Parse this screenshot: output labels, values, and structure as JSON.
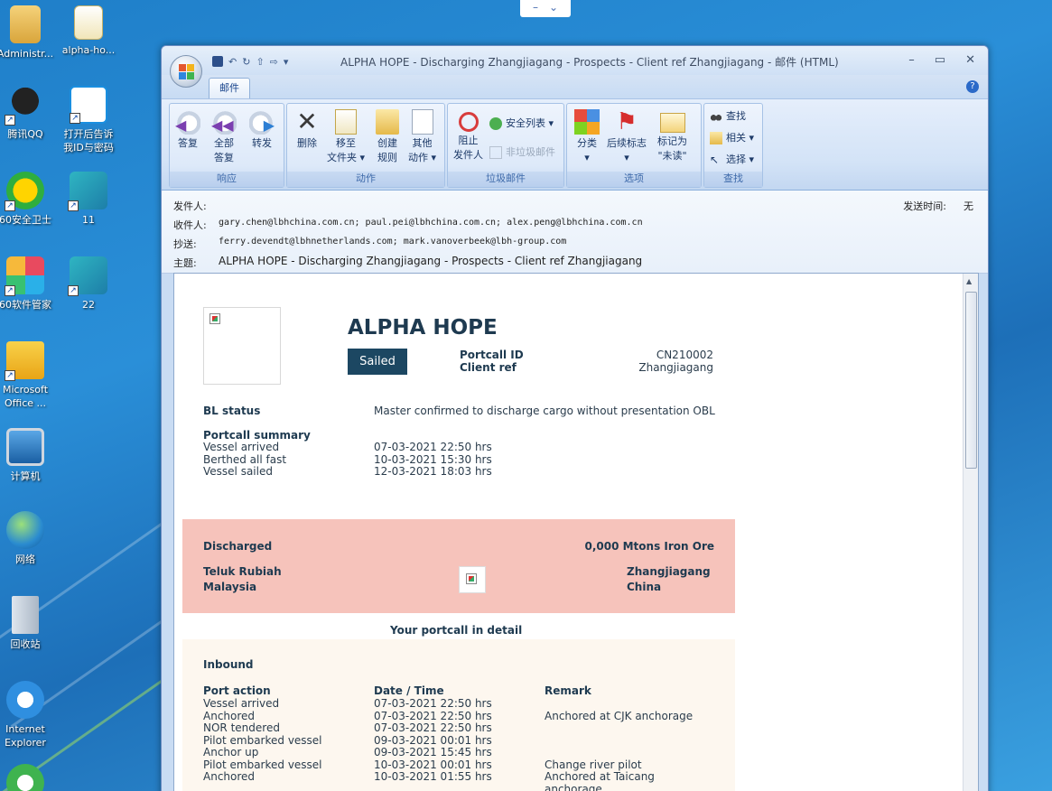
{
  "desktop": {
    "icons": [
      {
        "label": "Administr...",
        "icon": "folder-user-icon"
      },
      {
        "label": "alpha-ho...",
        "icon": "outlook-message-icon"
      },
      {
        "label": "腾讯QQ",
        "icon": "qq-penguin-icon"
      },
      {
        "label": "打开后告诉\n我ID与密码",
        "icon": "remote-desktop-icon"
      },
      {
        "label": "60安全卫士",
        "icon": "security-guard-icon"
      },
      {
        "label": "11",
        "icon": "registry-file-icon"
      },
      {
        "label": "60软件管家",
        "icon": "software-manager-icon"
      },
      {
        "label": "22",
        "icon": "registry-file-icon"
      },
      {
        "label": "Microsoft\nOffice ...",
        "icon": "office-outlook-icon"
      },
      {
        "label": "计算机",
        "icon": "computer-icon"
      },
      {
        "label": "网络",
        "icon": "network-globe-icon"
      },
      {
        "label": "回收站",
        "icon": "recycle-bin-icon"
      },
      {
        "label": "Internet\nExplorer",
        "icon": "internet-explorer-icon"
      }
    ]
  },
  "topbar": {
    "minus": "–",
    "chevron": "⌄"
  },
  "window": {
    "title": "ALPHA HOPE - Discharging Zhangjiagang - Prospects - Client ref Zhangjiagang  - 邮件 (HTML)",
    "min": "–",
    "max": "▭",
    "close": "✕",
    "tab": "邮件",
    "help": "?"
  },
  "ribbon": {
    "groups": {
      "respond": "响应",
      "actions": "动作",
      "junk": "垃圾邮件",
      "options": "选项",
      "find": "查找"
    },
    "buttons": {
      "reply": "答复",
      "reply_all_1": "全部",
      "reply_all_2": "答复",
      "forward": "转发",
      "delete": "删除",
      "move_1": "移至",
      "move_2": "文件夹 ▾",
      "create_1": "创建",
      "create_2": "规则",
      "other_1": "其他",
      "other_2": "动作 ▾",
      "block_1": "阻止",
      "block_2": "发件人",
      "safe_list": "安全列表 ▾",
      "not_junk": "非垃圾邮件",
      "categorize_1": "分类",
      "categorize_2": "▾",
      "followup_1": "后续标志",
      "followup_2": "▾",
      "mark_1": "标记为",
      "mark_2": "\"未读\"",
      "find": "查找",
      "related": "相关 ▾",
      "select": "选择 ▾"
    }
  },
  "header": {
    "from_label": "发件人:",
    "to_label": "收件人:",
    "to_value": "gary.chen@lbhchina.com.cn; paul.pei@lbhchina.com.cn; alex.peng@lbhchina.com.cn",
    "cc_label": "抄送:",
    "cc_value": "ferry.devendt@lbhnetherlands.com; mark.vanoverbeek@lbh-group.com",
    "subject_label": "主题:",
    "subject_value": "ALPHA HOPE - Discharging Zhangjiagang - Prospects - Client ref Zhangjiagang",
    "sent_label": "发送时间:",
    "sent_value": "无"
  },
  "message": {
    "vessel": "ALPHA HOPE",
    "status": "Sailed",
    "portcall_id_label": "Portcall ID",
    "portcall_id_value": "CN210002",
    "client_ref_label": "Client ref",
    "client_ref_value": "Zhangjiagang",
    "bl_status_label": "BL status",
    "bl_status_value": "Master confirmed to discharge cargo without presentation OBL",
    "summary_title": "Portcall summary",
    "summary": [
      {
        "label": "Vessel arrived",
        "value": "07-03-2021 22:50 hrs"
      },
      {
        "label": "Berthed all fast",
        "value": "10-03-2021 15:30 hrs"
      },
      {
        "label": "Vessel sailed",
        "value": "12-03-2021 18:03 hrs"
      }
    ],
    "discharged_label": "Discharged",
    "cargo": "0,000 Mtons Iron Ore",
    "origin_1": "Teluk Rubiah",
    "origin_2": "Malaysia",
    "dest_1": "Zhangjiagang",
    "dest_2": "China",
    "detail_title": "Your portcall in detail",
    "inbound_title": "Inbound",
    "col_action": "Port action",
    "col_date": "Date / Time",
    "col_remark": "Remark",
    "rows": [
      {
        "action": "Vessel arrived",
        "date": "07-03-2021 22:50 hrs",
        "remark": ""
      },
      {
        "action": "Anchored",
        "date": "07-03-2021 22:50 hrs",
        "remark": "Anchored at CJK anchorage"
      },
      {
        "action": "NOR tendered",
        "date": "07-03-2021 22:50 hrs",
        "remark": ""
      },
      {
        "action": "Pilot embarked vessel",
        "date": "09-03-2021 00:01 hrs",
        "remark": ""
      },
      {
        "action": "Anchor up",
        "date": "09-03-2021 15:45 hrs",
        "remark": ""
      },
      {
        "action": "Pilot embarked vessel",
        "date": "10-03-2021 00:01 hrs",
        "remark": "Change river pilot"
      },
      {
        "action": "Anchored",
        "date": "10-03-2021 01:55 hrs",
        "remark": "Anchored at Taicang anchorage"
      }
    ]
  }
}
